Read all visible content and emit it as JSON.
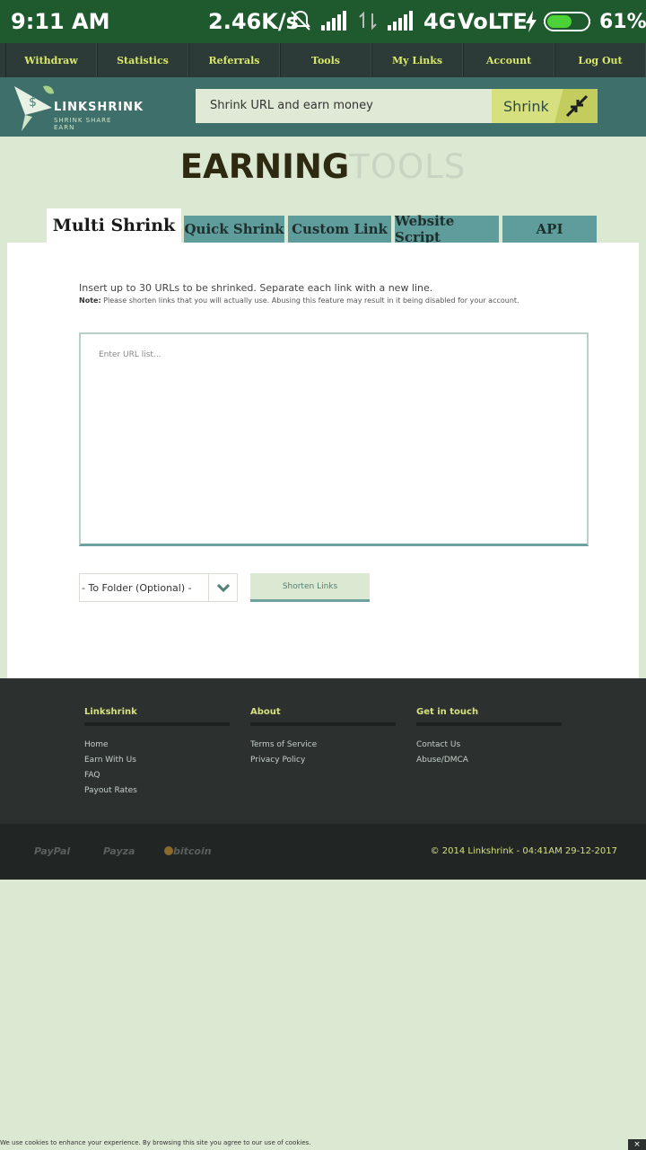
{
  "status_bar": {
    "time": "9:11 AM",
    "speed": "2.46K/s",
    "network": "4G",
    "volte": "VoLTE",
    "battery_percent": "61%",
    "battery_level": 0.61
  },
  "nav": {
    "items": [
      "Withdraw",
      "Statistics",
      "Referrals",
      "Tools",
      "My Links",
      "Account",
      "Log Out"
    ]
  },
  "header": {
    "logo_text": "LINKSHRINK",
    "logo_sub": "SHRINK  SHARE  EARN",
    "search_placeholder": "Shrink URL and earn money",
    "shrink_label": "Shrink"
  },
  "title": {
    "part1": "EARNING",
    "part2": "TOOLS"
  },
  "tabs": [
    "Multi Shrink",
    "Quick Shrink",
    "Custom Link",
    "Website Script",
    "API"
  ],
  "multi_shrink": {
    "instructions": "Insert up to 30 URLs to be shrinked. Separate each link with a new line.",
    "note_label": "Note:",
    "note_text": " Please shorten links that you will actually use. Abusing this feature may result in it being disabled for your account.",
    "url_placeholder": "Enter URL list...",
    "folder_selected": "- To Folder (Optional) -",
    "shorten_label": "Shorten Links"
  },
  "footer": {
    "col1": {
      "heading": "Linkshrink",
      "links": [
        "Home",
        "Earn With Us",
        "FAQ",
        "Payout Rates"
      ]
    },
    "col2": {
      "heading": "About",
      "links": [
        "Terms of Service",
        "Privacy Policy"
      ]
    },
    "col3": {
      "heading": "Get in touch",
      "links": [
        "Contact Us",
        "Abuse/DMCA"
      ]
    },
    "payment": [
      "PayPal",
      "Payza",
      "bitcoin"
    ],
    "copyright": "© 2014 Linkshrink - 04:41AM 29-12-2017"
  },
  "cookie": {
    "text": "We use cookies to enhance your experience. By browsing this site you agree to our use of cookies.",
    "close": "×"
  },
  "colors": {
    "accent": "#d6e07f",
    "header_bg": "#3f6f6a",
    "tab_bg": "#5f9c9c",
    "page_bg": "#dce9d2"
  }
}
